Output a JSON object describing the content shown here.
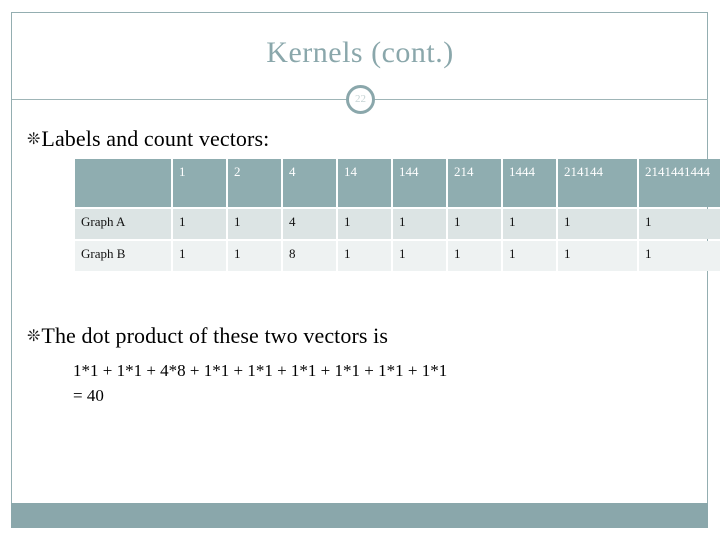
{
  "slide": {
    "title": "Kernels (cont.)",
    "page_number": "22",
    "accent_color": "#8aa7ab",
    "header_fill": "#8fadb0",
    "row_a_fill": "#dce4e4",
    "row_b_fill": "#eef2f2",
    "bullet_glyph": "❊"
  },
  "bullets": [
    {
      "id": "labels",
      "text": "Labels and count vectors:"
    },
    {
      "id": "dotproduct",
      "text": "The dot product of these two vectors is"
    }
  ],
  "equation": {
    "line1": "1*1 + 1*1 + 4*8 + 1*1 + 1*1 + 1*1 + 1*1 + 1*1 + 1*1",
    "line2": "= 40"
  },
  "table": {
    "headers": [
      "",
      "1",
      "2",
      "4",
      "14",
      "144",
      "214",
      "1444",
      "214144",
      "2141441444"
    ],
    "rows": [
      {
        "label": "Graph A",
        "values": [
          "1",
          "1",
          "4",
          "1",
          "1",
          "1",
          "1",
          "1",
          "1"
        ]
      },
      {
        "label": "Graph B",
        "values": [
          "1",
          "1",
          "8",
          "1",
          "1",
          "1",
          "1",
          "1",
          "1"
        ]
      }
    ]
  }
}
